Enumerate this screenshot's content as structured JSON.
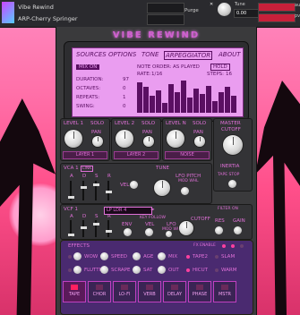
{
  "header": {
    "instrument_name": "Vibe Rewind",
    "preset_name": "ARP-Cherry Springer",
    "purge_label": "Purge",
    "tune_label": "Tune",
    "tune_value": "0.00",
    "aux_label": "aux",
    "pv_label": "pv"
  },
  "title": "VIBE REWIND",
  "tabs": [
    "SOURCES",
    "OPTIONS",
    "TONE",
    "ARPEGGIATOR",
    "ABOUT"
  ],
  "arp": {
    "mode_chip": "MIX ON",
    "note_order_label": "NOTE ORDER:",
    "note_order_value": "AS PLAYED",
    "hold_label": "HOLD",
    "rate_label": "RATE:",
    "rate_value": "1/16",
    "steps_label": "STEPS:",
    "steps_value": "16",
    "params": [
      {
        "label": "DURATION:",
        "value": "97"
      },
      {
        "label": "OCTAVES:",
        "value": "0"
      },
      {
        "label": "REPEATS:",
        "value": "1"
      },
      {
        "label": "SWING:",
        "value": "0"
      }
    ],
    "step_levels": [
      0.9,
      0.75,
      0.5,
      0.65,
      0.3,
      0.85,
      0.6,
      0.95,
      0.45,
      0.7,
      0.55,
      0.8,
      0.35,
      0.6,
      0.75,
      0.5
    ]
  },
  "layers": [
    {
      "title": "LEVEL 1",
      "solo": "SOLO",
      "pan": "PAN",
      "name": "LAYER 1"
    },
    {
      "title": "LEVEL 2",
      "solo": "SOLO",
      "pan": "PAN",
      "name": "LAYER 2"
    },
    {
      "title": "LEVEL N",
      "solo": "SOLO",
      "pan": "PAN",
      "name": "NOISE"
    }
  ],
  "master": {
    "title": "MASTER",
    "cutoff": "CUTOFF",
    "inertia": "INERTIA",
    "tape_stop": "TAPE STOP"
  },
  "vca": {
    "title": "VCA 1",
    "link": "LINK",
    "adsr": [
      "A",
      "D",
      "S",
      "R"
    ],
    "vel": "VEL",
    "tune": "TUNE",
    "lfo_pitch": "LFO PITCH",
    "mod_whl": "MOD WHL"
  },
  "vcf": {
    "title": "VCF 1",
    "mode": "LP LDR 4",
    "adsr": [
      "A",
      "D",
      "S",
      "R"
    ],
    "env": "ENV",
    "key_follow": "KEY FOLLOW",
    "vel": "VEL",
    "lfo": "LFO",
    "cutoff": "CUTOFF",
    "res": "RES",
    "gain": "GAIN",
    "filter_on": "FILTER ON",
    "mod_whl": "MOD WHL"
  },
  "effects": {
    "title": "EFFECTS",
    "fx_enable": "FX ENABLE",
    "row1": [
      "WOW",
      "SPEED",
      "AGE",
      "MIX"
    ],
    "row2": [
      "FLUTTR",
      "SCRAPE",
      "SAT",
      "OUT"
    ],
    "side": [
      "TAPE2",
      "SLAM",
      "HICUT",
      "WARM"
    ],
    "buttons": [
      "TAPE",
      "CHOR",
      "LO-FI",
      "VERB",
      "DELAY",
      "PHASE",
      "MSTR"
    ],
    "active_button": 0
  },
  "colors": {
    "accent": "#e070d8",
    "lcd": "#ea9df0",
    "bg_pink": "#ff6fa8",
    "button_red": "#ff2060"
  }
}
